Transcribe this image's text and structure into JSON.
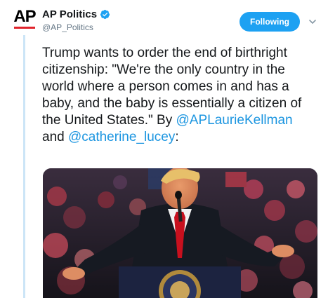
{
  "account": {
    "avatar_text": "AP",
    "name": "AP Politics",
    "handle": "@AP_Politics",
    "verified": true,
    "verified_icon": "verified-badge-icon"
  },
  "actions": {
    "follow_label": "Following",
    "more_icon": "chevron-down-icon"
  },
  "tweet": {
    "text_main": "Trump wants to order the end of birthright citizenship: \"We're the only country in the world where a person comes in and has a baby, and the baby is essentially a citizen of the United States.\" By ",
    "mention_1": "@APLaurieKellman",
    "joiner": " and ",
    "mention_2": "@catherine_lucey",
    "trailing": ":"
  },
  "media": {
    "type": "photo"
  },
  "colors": {
    "accent": "#1da1f2",
    "link": "#1b95e0",
    "thread_line": "#cce5f7",
    "ap_red": "#e0242c"
  }
}
